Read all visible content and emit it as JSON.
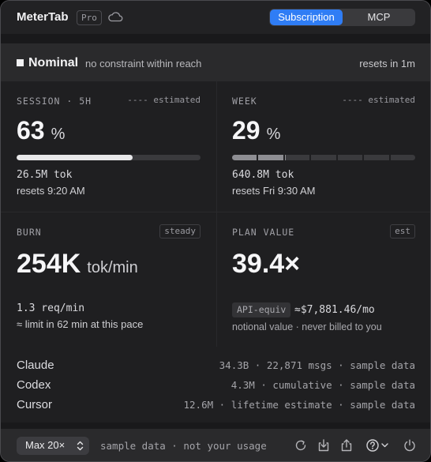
{
  "header": {
    "app_title": "MeterTab",
    "pro_badge": "Pro",
    "tabs": [
      {
        "label": "Subscription",
        "active": true
      },
      {
        "label": "MCP",
        "active": false
      }
    ]
  },
  "status": {
    "title": "Nominal",
    "description": "no constraint within reach",
    "resets": "resets in 1m"
  },
  "cards": {
    "session": {
      "label": "SESSION · 5H",
      "tag": "---- estimated",
      "value": "63",
      "unit": "%",
      "progress_percent": 63,
      "tokens": "26.5M tok",
      "resets": "resets 9:20 AM"
    },
    "week": {
      "label": "WEEK",
      "tag": "---- estimated",
      "value": "29",
      "unit": "%",
      "progress_percent": 29,
      "segments": 7,
      "tokens": "640.8M tok",
      "resets": "resets Fri 9:30 AM"
    },
    "burn": {
      "label": "BURN",
      "tag": "steady",
      "value": "254K",
      "unit": "tok/min",
      "rate": "1.3 req/min",
      "limit_note": "≈ limit in 62 min at this pace"
    },
    "plan_value": {
      "label": "PLAN VALUE",
      "tag": "est",
      "value": "39.4×",
      "api_chip": "API-equiv",
      "api_value": "≈$7,881.46/mo",
      "note": "notional value · never billed to you"
    }
  },
  "providers": [
    {
      "name": "Claude",
      "detail": "34.3B · 22,871 msgs · sample data"
    },
    {
      "name": "Codex",
      "detail": "4.3M · cumulative · sample data"
    },
    {
      "name": "Cursor",
      "detail": "12.6M · lifetime estimate · sample data"
    }
  ],
  "footer": {
    "plan": "Max 20×",
    "note": "sample data · not your usage"
  },
  "colors": {
    "accent": "#2f7df5",
    "background": "#1f1f21",
    "panel": "#2a2a2c"
  },
  "icons": [
    "cloud-icon",
    "chevron-updown-icon",
    "refresh-icon",
    "download-icon",
    "share-icon",
    "help-icon",
    "power-icon"
  ]
}
